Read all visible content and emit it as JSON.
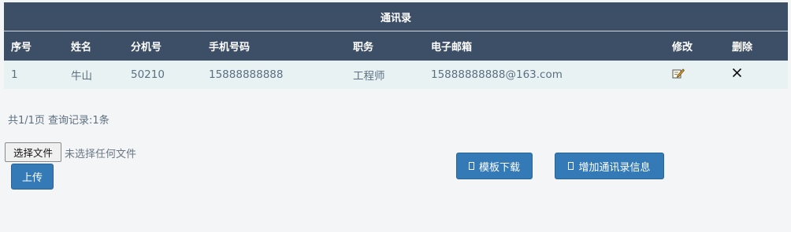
{
  "table": {
    "title": "通讯录",
    "headers": [
      "序号",
      "姓名",
      "分机号",
      "手机号码",
      "职务",
      "电子邮箱",
      "修改",
      "删除"
    ],
    "rows": [
      {
        "index": "1",
        "name": "牛山",
        "extension": "50210",
        "mobile": "15888888888",
        "position": "工程师",
        "email": "15888888888@163.com",
        "edit_icon": "edit-icon",
        "delete_icon": "close-icon"
      }
    ]
  },
  "pagination": {
    "summary": "共1/1页 查询记录:1条"
  },
  "upload": {
    "choose_file_label": "选择文件",
    "file_status": "未选择任何文件",
    "upload_label": "上传"
  },
  "actions": {
    "template_download_label": "模板下载",
    "add_contact_label": "增加通讯录信息"
  },
  "colors": {
    "header_bg": "#3d4f66",
    "row_bg": "#e8f2f2",
    "button_blue": "#337ab7",
    "page_bg": "#f4f5f7"
  }
}
